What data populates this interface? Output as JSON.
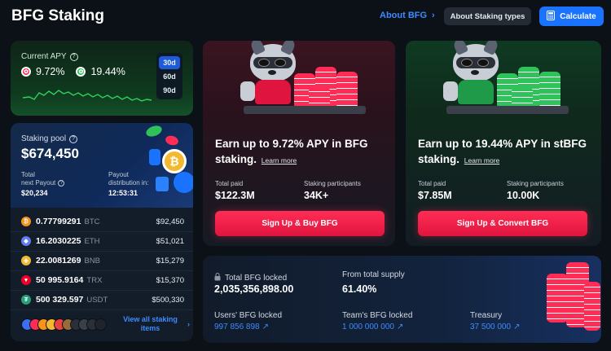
{
  "header": {
    "title": "BFG Staking",
    "about_link": "About BFG",
    "about_staking_btn": "About Staking types",
    "calculate_btn": "Calculate"
  },
  "apy": {
    "label": "Current APY",
    "bfg_apy": "9.72%",
    "sbfg_apy": "19.44%",
    "periods": [
      "30d",
      "60d",
      "90d"
    ],
    "selected_period": "30d",
    "colors": {
      "line": "#2fd25e",
      "active_period": "#1d5bd8"
    }
  },
  "pool": {
    "label": "Staking pool",
    "value": "$674,450",
    "total_next_payout_label_1": "Total",
    "total_next_payout_label_2": "next Payout",
    "total_next_payout": "$20,234",
    "payout_distribution_label_1": "Payout",
    "payout_distribution_label_2": "distribution in:",
    "payout_timer": "12:53:31",
    "assets": [
      {
        "amount": "0.77799291",
        "symbol": "BTC",
        "usd": "$92,450",
        "icon": "bitcoin-icon",
        "color": "#f7931a",
        "glyph": "₿"
      },
      {
        "amount": "16.2030225",
        "symbol": "ETH",
        "usd": "$51,021",
        "icon": "ethereum-icon",
        "color": "#627eea",
        "glyph": "◆"
      },
      {
        "amount": "22.0081269",
        "symbol": "BNB",
        "usd": "$15,279",
        "icon": "bnb-icon",
        "color": "#f3ba2f",
        "glyph": "◈"
      },
      {
        "amount": "50 995.9164",
        "symbol": "TRX",
        "usd": "$15,370",
        "icon": "tron-icon",
        "color": "#ef0027",
        "glyph": "▼"
      },
      {
        "amount": "500 329.597",
        "symbol": "USDT",
        "usd": "$500,330",
        "icon": "tether-icon",
        "color": "#26a17b",
        "glyph": "₮"
      }
    ],
    "view_all_1": "View all staking",
    "view_all_2": "items"
  },
  "bfg_card": {
    "earn_text": "Earn up to 9.72% APY in BFG staking.",
    "learn_more": "Learn more",
    "total_paid_label": "Total paid",
    "total_paid": "$122.3M",
    "participants_label": "Staking participants",
    "participants": "34K+",
    "cta": "Sign Up & Buy BFG",
    "chip_color": "#ff2d55"
  },
  "sbfg_card": {
    "earn_text": "Earn up to 19.44% APY in stBFG staking.",
    "learn_more": "Learn more",
    "total_paid_label": "Total paid",
    "total_paid": "$7.85M",
    "participants_label": "Staking participants",
    "participants": "10.00K",
    "cta": "Sign Up & Convert BFG",
    "chip_color": "#2fc25a"
  },
  "locked": {
    "total_label": "Total BFG locked",
    "total_value": "2,035,356,898.00",
    "supply_label": "From total supply",
    "supply_value": "61.40%",
    "users_label": "Users' BFG locked",
    "users_value": "997 856 898",
    "team_label": "Team's BFG locked",
    "team_value": "1 000 000 000",
    "treasury_label": "Treasury",
    "treasury_value": "37 500 000"
  }
}
